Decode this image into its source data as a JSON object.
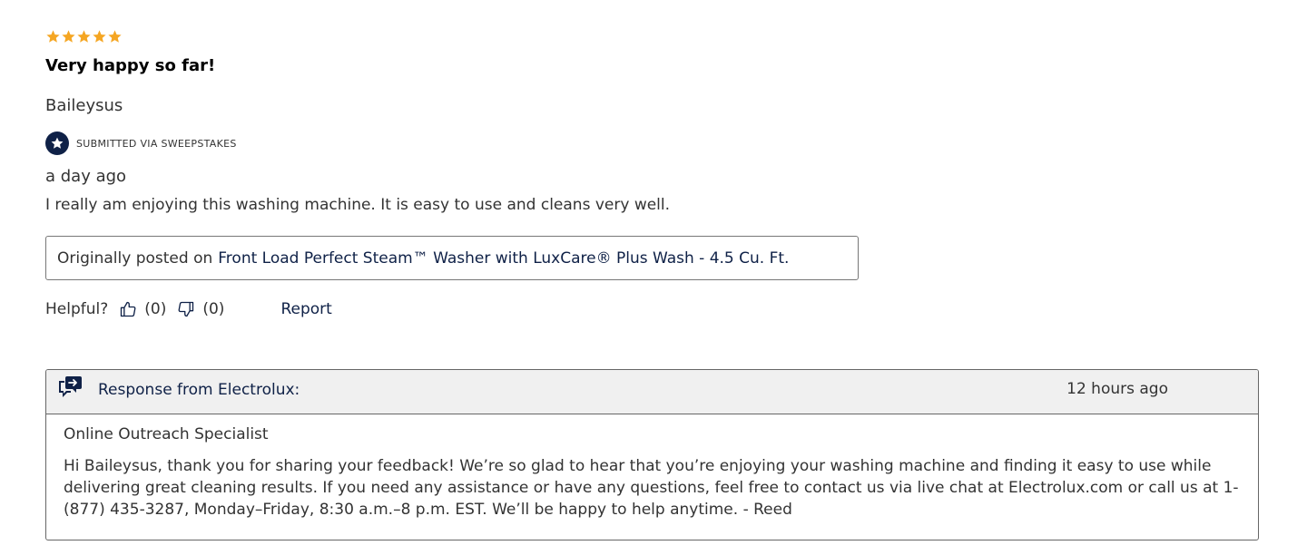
{
  "review": {
    "rating": 5,
    "rating_max": 5,
    "star_color": "#f5a623",
    "title": "Very happy so far!",
    "author": "Baileysus",
    "badge": {
      "icon": "star-icon",
      "text": "SUBMITTED VIA SWEEPSTAKES",
      "color": "#0f2147"
    },
    "date": "a day ago",
    "body": "I really am enjoying this washing machine. It is easy to use and cleans very well.",
    "originally_posted": {
      "prefix": "Originally posted on",
      "product": "Front Load Perfect Steam™ Washer with LuxCare® Plus Wash - 4.5 Cu. Ft."
    },
    "helpful": {
      "label": "Helpful?",
      "yes_count": "(0)",
      "no_count": "(0)",
      "report_label": "Report"
    }
  },
  "response": {
    "icon": "chat-reply-icon",
    "from": "Response from Electrolux:",
    "time": "12 hours ago",
    "role": "Online Outreach Specialist",
    "text": "Hi Baileysus, thank you for sharing your feedback! We’re so glad to hear that you’re enjoying your washing machine and finding it easy to use while delivering great cleaning results. If you need any assistance or have any questions, feel free to contact us via live chat at Electrolux.com or call us at 1-(877) 435-3287, Monday–Friday, 8:30 a.m.–8 p.m. EST. We’ll be happy to help anytime. - Reed"
  },
  "colors": {
    "accent": "#0f2147",
    "text": "#333333",
    "border": "#777777",
    "header_bg": "#f0f0f0"
  }
}
